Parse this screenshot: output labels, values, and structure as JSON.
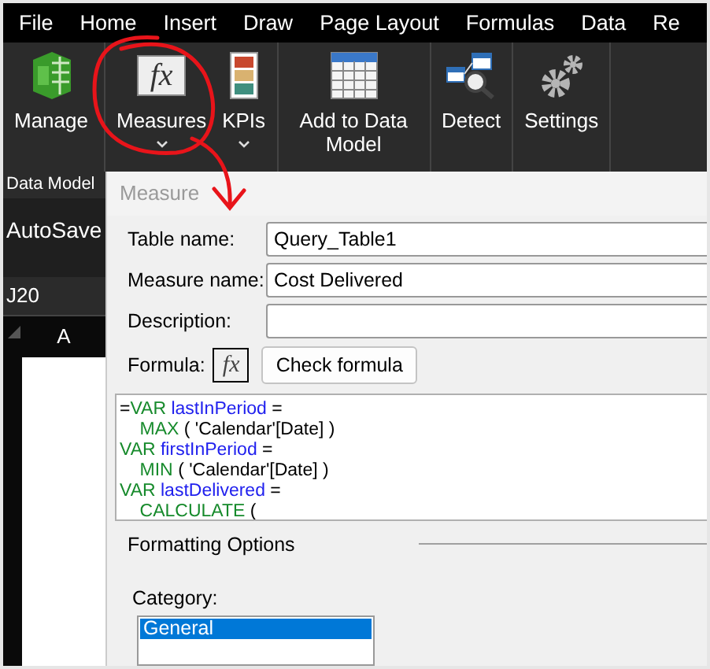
{
  "menu": [
    {
      "label": "File"
    },
    {
      "label": "Home"
    },
    {
      "label": "Insert"
    },
    {
      "label": "Draw"
    },
    {
      "label": "Page Layout"
    },
    {
      "label": "Formulas"
    },
    {
      "label": "Data"
    },
    {
      "label": "Re"
    }
  ],
  "ribbon": [
    {
      "label": "Manage",
      "dropdown": false
    },
    {
      "label": "Measures",
      "glyph": "fx",
      "dropdown": true
    },
    {
      "label": "KPIs",
      "dropdown": true
    },
    {
      "label": "Add to Data Model",
      "dropdown": false
    },
    {
      "label": "Detect",
      "dropdown": false
    },
    {
      "label": "Settings",
      "dropdown": false
    }
  ],
  "group_label": "Data Model",
  "autosave": "AutoSave",
  "name_box": "J20",
  "column_header": "A",
  "dialog": {
    "title": "Measure",
    "fields": [
      {
        "label": "Table name:",
        "value": "Query_Table1"
      },
      {
        "label": "Measure name:",
        "value": "Cost Delivered"
      },
      {
        "label": "Description:"
      }
    ],
    "formula_label": "Formula:",
    "fx_button": "fx",
    "check_button": "Check formula",
    "formula_lines": [
      [
        {
          "text": "=",
          "kind": "plain"
        },
        {
          "text": "VAR",
          "kind": "keyword"
        },
        {
          "text": " lastInPeriod",
          "kind": "name"
        },
        {
          "text": " =",
          "kind": "plain"
        }
      ],
      [
        {
          "text": "    MAX",
          "kind": "keyword"
        },
        {
          "text": " ( 'Calendar'[Date] )",
          "kind": "plain"
        }
      ],
      [
        {
          "text": "VAR",
          "kind": "keyword"
        },
        {
          "text": " firstInPeriod",
          "kind": "name"
        },
        {
          "text": " =",
          "kind": "plain"
        }
      ],
      [
        {
          "text": "    MIN",
          "kind": "keyword"
        },
        {
          "text": " ( 'Calendar'[Date] )",
          "kind": "plain"
        }
      ],
      [
        {
          "text": "VAR",
          "kind": "keyword"
        },
        {
          "text": " lastDelivered",
          "kind": "name"
        },
        {
          "text": " =",
          "kind": "plain"
        }
      ],
      [
        {
          "text": "    CALCULATE",
          "kind": "keyword"
        },
        {
          "text": " (",
          "kind": "plain"
        }
      ]
    ],
    "formatting_title": "Formatting Options",
    "category_label": "Category:",
    "categories": [
      {
        "label": "General",
        "selected": true
      }
    ]
  }
}
